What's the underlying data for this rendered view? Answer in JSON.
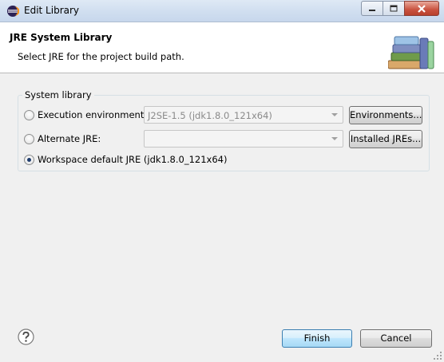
{
  "window": {
    "title": "Edit Library",
    "controls": [
      "minimize-icon",
      "maximize-icon",
      "close-icon"
    ]
  },
  "header": {
    "title": "JRE System Library",
    "description": "Select JRE for the project build path.",
    "icon": "library-books-icon"
  },
  "system_library": {
    "legend": "System library",
    "options": [
      {
        "label": "Execution environment:",
        "selected": false,
        "combo_value": "J2SE-1.5 (jdk1.8.0_121x64)",
        "combo_enabled": false,
        "button_label": "Environments..."
      },
      {
        "label": "Alternate JRE:",
        "selected": false,
        "combo_value": "",
        "combo_enabled": false,
        "button_label": "Installed JREs..."
      },
      {
        "label": "Workspace default JRE (jdk1.8.0_121x64)",
        "selected": true
      }
    ]
  },
  "footer": {
    "help_icon": "help-icon",
    "finish_label": "Finish",
    "cancel_label": "Cancel"
  },
  "colors": {
    "accent": "#3c7fb1",
    "dialog_bg": "#f0f0f0",
    "header_bg": "#ffffff"
  }
}
